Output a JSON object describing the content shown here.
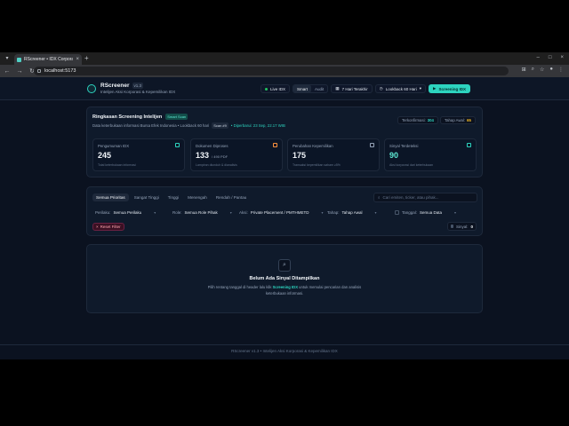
{
  "browser": {
    "tab_title": "RScreener • IDX Corporate Act...",
    "url": "localhost:5173"
  },
  "header": {
    "brand": "RScreener",
    "version": "v1.3",
    "subtitle": "Intelijen Aksi Korporasi & Kepemilikan IDX",
    "live_label": "Live IDX",
    "seg_smart": "Smart",
    "seg_audit": "Audit",
    "range_label": "7 Hari Terakhir",
    "lookback_label": "Lookback 60 Hari",
    "cta_label": "Screening IDX",
    "accent": "#2dd4bf"
  },
  "summary": {
    "title": "Ringkasan Screening Intelijen",
    "badge": "Smart Scan",
    "sub": "Data keterbukaan informasi Bursa Efek Indonesia • Lookback 60 hari",
    "scan_chip": "Scan #9",
    "updated": "• Diperbarui: 23 Sep, 22.17 WIB",
    "confirmed_label": "Terkonfirmasi:",
    "confirmed_value": "304",
    "early_label": "Tahap Awal:",
    "early_value": "65",
    "metrics": [
      {
        "label": "Pengumuman IDX",
        "value": "245",
        "suffix": "",
        "desc": "Total keterbukaan informasi"
      },
      {
        "label": "Dokumen Diproses",
        "value": "133",
        "suffix": "/ 490 PDF",
        "desc": "Lampiran diunduh & dianalisis"
      },
      {
        "label": "Perubahan Kepemilikan",
        "value": "175",
        "suffix": "",
        "desc": "Transaksi kepemilikan saham ≥5%"
      },
      {
        "label": "Sinyal Terdeteksi",
        "value": "90",
        "suffix": "",
        "desc": "Aksi korporasi dari keterbukaan"
      }
    ]
  },
  "filters": {
    "tabs": [
      "Semua Prioritas",
      "Sangat Tinggi",
      "Tinggi",
      "Menengah",
      "Rendah / Pantau"
    ],
    "search_placeholder": "Cari emiten, ticker, atau pihak...",
    "perilaku_label": "Perilaku:",
    "perilaku_value": "Semua Perilaku",
    "role_label": "Role:",
    "role_value": "Semua Role Pihak",
    "aksi_label": "Aksi:",
    "aksi_value": "Private Placement / PMTHMETD",
    "tahap_label": "Tahap:",
    "tahap_value": "Tahap Awal",
    "tanggal_label": "Tanggal:",
    "tanggal_value": "Semua Data",
    "reset_label": "Reset Filter",
    "signal_label": "Sinyal:",
    "signal_value": "0"
  },
  "empty": {
    "title": "Belum Ada Sinyal Ditampilkan",
    "desc_pre": "Pilih rentang tanggal di header lalu klik",
    "desc_link": "Screening IDX",
    "desc_post": "untuk memulai pencarian dan analisis keterbukaan informasi."
  },
  "footer": {
    "text": "RScreener v1.3 • Intelijen Aksi Korporasi & Kepemilikan IDX"
  }
}
